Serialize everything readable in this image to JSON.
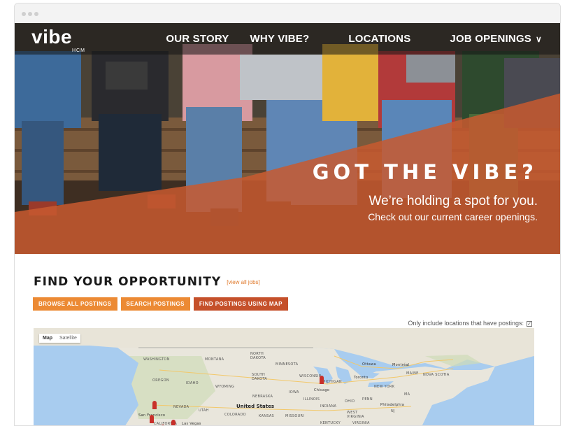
{
  "nav": {
    "logo": "vibe",
    "logo_sub": "HCM",
    "items": [
      {
        "label": "OUR STORY"
      },
      {
        "label": "WHY VIBE?"
      },
      {
        "label": "LOCATIONS"
      },
      {
        "label": "JOB OPENINGS"
      }
    ]
  },
  "hero": {
    "headline": "GOT THE VIBE?",
    "subhead": "We’re holding a spot for you.",
    "subtext": "Check out our current career openings."
  },
  "find": {
    "title": "FIND YOUR OPPORTUNITY",
    "view_all": "[view all jobs]",
    "buttons": [
      {
        "label": "BROWSE ALL POSTINGS"
      },
      {
        "label": "SEARCH POSTINGS"
      },
      {
        "label": "FIND POSTINGS USING MAP"
      }
    ],
    "filter_label": "Only include locations that have postings:",
    "filter_checked": true
  },
  "map": {
    "tabs": [
      "Map",
      "Satellite"
    ],
    "labels": {
      "washington": "WASHINGTON",
      "montana": "MONTANA",
      "north_dakota": "NORTH\nDAKOTA",
      "minnesota": "MINNESOTA",
      "ottawa": "Ottawa",
      "montreal": "Montréal",
      "maine": "MAINE",
      "nova_scotia": "NOVA SCOTIA",
      "oregon": "OREGON",
      "idaho": "IDAHO",
      "south_dakota": "SOUTH\nDAKOTA",
      "wisconsin": "WISCONSIN",
      "michigan": "MICHIGAN",
      "toronto": "Toronto",
      "new_york": "NEW YORK",
      "wyoming": "WYOMING",
      "iowa": "IOWA",
      "chicago": "Chicago",
      "nebraska": "NEBRASKA",
      "illinois": "ILLINOIS",
      "ohio": "OHIO",
      "penn": "PENN",
      "nevada": "NEVADA",
      "utah": "UTAH",
      "united_states": "United States",
      "indiana": "INDIANA",
      "philadelphia": "Philadelphia",
      "nj": "NJ",
      "san_francisco": "San Francisco",
      "colorado": "COLORADO",
      "kansas": "KANSAS",
      "missouri": "MISSOURI",
      "west_virginia": "WEST\nVIRGINIA",
      "california": "CALIFORNIA",
      "las_vegas": "Las Vegas",
      "kentucky": "KENTUCKY",
      "virginia": "VIRGINIA",
      "ma": "MA"
    }
  },
  "colors": {
    "accent_orange": "#ec8a34",
    "accent_red": "#c5502a",
    "hero_overlay": "#c75a30"
  }
}
